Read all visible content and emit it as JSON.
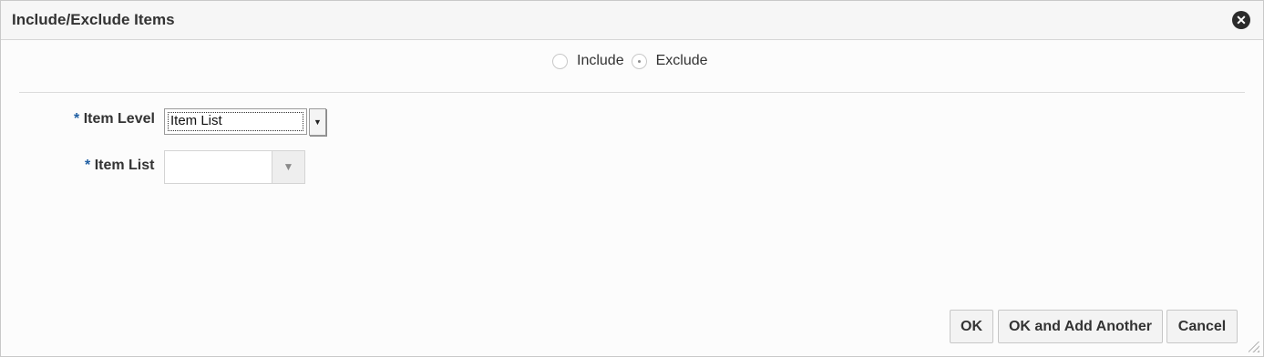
{
  "dialog": {
    "title": "Include/Exclude Items",
    "close_icon": "close-circle-icon"
  },
  "mode": {
    "options": [
      {
        "label": "Include",
        "selected": false
      },
      {
        "label": "Exclude",
        "selected": true
      }
    ]
  },
  "form": {
    "required_mark": "*",
    "item_level": {
      "label": "Item Level",
      "value": "Item List",
      "icon": "dropdown-arrow-icon"
    },
    "item_list": {
      "label": "Item List",
      "value": "",
      "icon": "dropdown-arrow-icon"
    }
  },
  "buttons": {
    "ok": "OK",
    "ok_add_another": "OK and Add Another",
    "cancel": "Cancel"
  },
  "colors": {
    "required_accent": "#1f5fa3",
    "title_bar": "#f6f6f6",
    "button_bg": "#f3f3f3"
  }
}
